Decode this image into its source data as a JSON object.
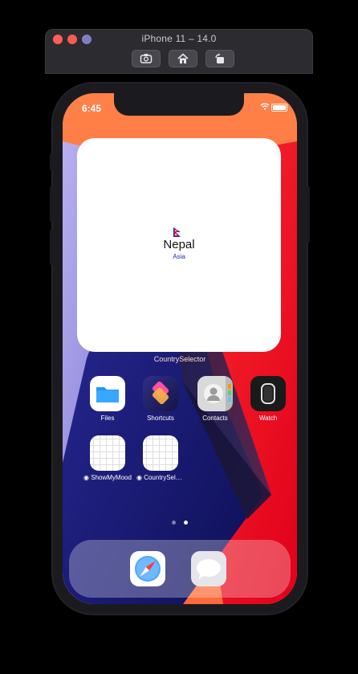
{
  "simulator": {
    "title": "iPhone 11 – 14.0",
    "tools": [
      "camera-icon",
      "home-icon",
      "rotate-icon"
    ]
  },
  "status_bar": {
    "time": "6:45",
    "icons": [
      "wifi-icon",
      "battery-icon"
    ]
  },
  "widget": {
    "country": "Nepal",
    "region": "Asia",
    "caption": "CountrySelector",
    "flag_icon": "nepal-flag-icon"
  },
  "apps": [
    {
      "label": "Files",
      "icon": "folder-icon"
    },
    {
      "label": "Shortcuts",
      "icon": "shortcuts-icon"
    },
    {
      "label": "Contacts",
      "icon": "contacts-icon"
    },
    {
      "label": "Watch",
      "icon": "watch-icon"
    },
    {
      "label": "◉ ShowMyMood",
      "icon": "grid-app-icon"
    },
    {
      "label": "◉ CountrySelec...",
      "icon": "grid-app-icon"
    }
  ],
  "page_indicator": {
    "pages": 2,
    "current": 2
  },
  "dock": {
    "apps": [
      "safari-icon",
      "messages-icon"
    ]
  },
  "colors": {
    "accent_orange": "#ff7a3a",
    "accent_red": "#ff1c1c",
    "accent_navy": "#15186b",
    "widget_region": "#1f2f9a"
  }
}
